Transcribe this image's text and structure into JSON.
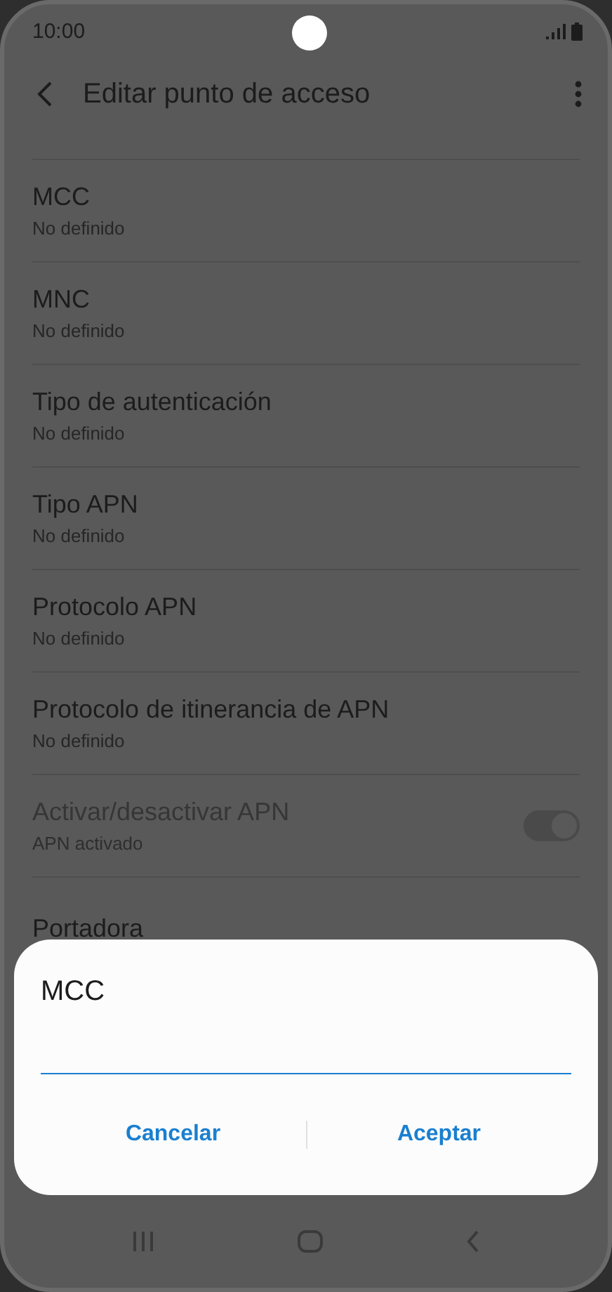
{
  "status_bar": {
    "time": "10:00"
  },
  "header": {
    "title": "Editar punto de acceso"
  },
  "settings": [
    {
      "title": "MCC",
      "subtitle": "No definido",
      "disabled": false
    },
    {
      "title": "MNC",
      "subtitle": "No definido",
      "disabled": false
    },
    {
      "title": "Tipo de autenticación",
      "subtitle": "No definido",
      "disabled": false
    },
    {
      "title": "Tipo APN",
      "subtitle": "No definido",
      "disabled": false
    },
    {
      "title": "Protocolo APN",
      "subtitle": "No definido",
      "disabled": false
    },
    {
      "title": "Protocolo de itinerancia de APN",
      "subtitle": "No definido",
      "disabled": false
    },
    {
      "title": "Activar/desactivar APN",
      "subtitle": "APN activado",
      "disabled": true,
      "kind": "toggle",
      "on": true
    },
    {
      "title": "Portadora",
      "disabled": false
    }
  ],
  "dialog": {
    "title": "MCC",
    "buttons": [
      "Cancelar",
      "Aceptar"
    ]
  }
}
